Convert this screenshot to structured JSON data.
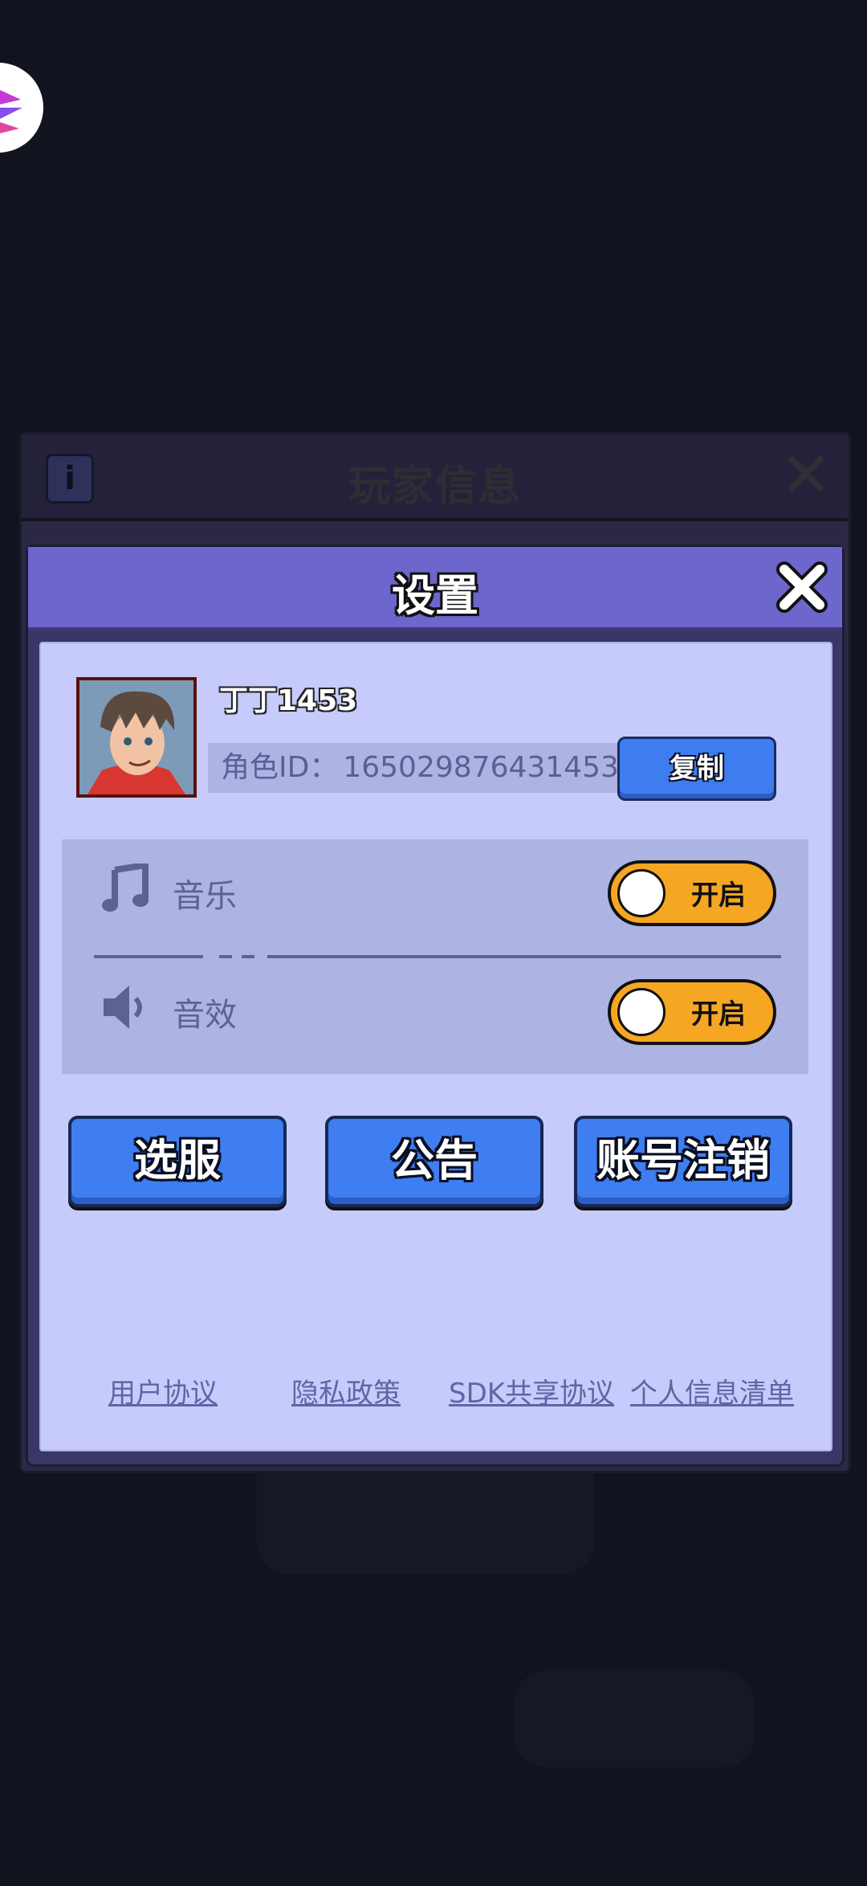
{
  "player_info": {
    "title": "玩家信息",
    "info_label": "i"
  },
  "settings": {
    "title": "设置",
    "profile": {
      "name": "丁丁1453",
      "id_label": "角色ID：",
      "id_value": "165029876431453",
      "copy_label": "复制"
    },
    "toggles": [
      {
        "label": "音乐",
        "icon": "music-note-icon",
        "state_label": "开启",
        "on": true
      },
      {
        "label": "音效",
        "icon": "speaker-icon",
        "state_label": "开启",
        "on": true
      }
    ],
    "buttons": {
      "select_server": "选服",
      "announcement": "公告",
      "account_cancel": "账号注销"
    },
    "links": {
      "user_agreement": "用户协议",
      "privacy_policy": "隐私政策",
      "sdk_sharing": "SDK共享协议",
      "personal_info_list": "个人信息清单"
    }
  },
  "colors": {
    "header_purple": "#6d66cc",
    "body_lavender": "#c6cbfb",
    "button_blue": "#3f7ef1",
    "toggle_orange": "#f5a623"
  }
}
